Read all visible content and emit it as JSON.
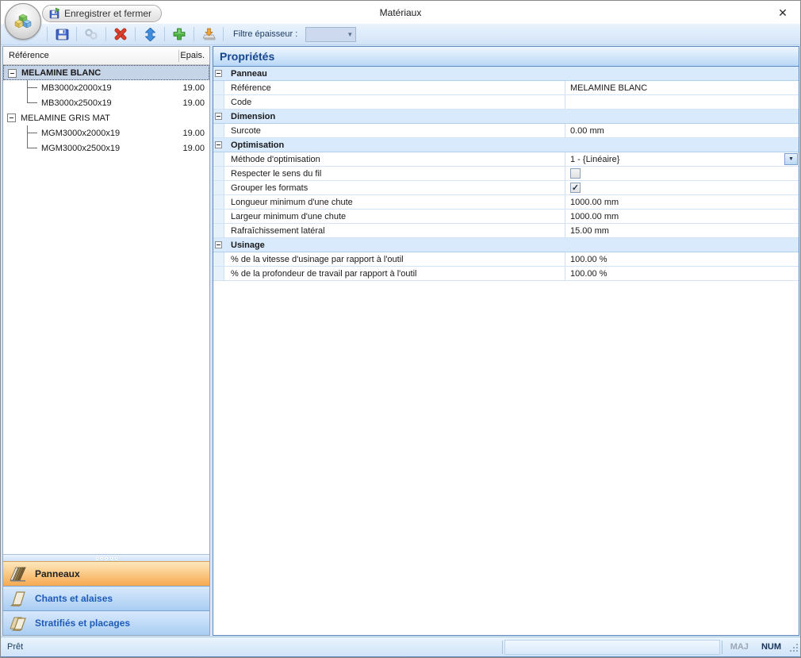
{
  "window": {
    "title": "Matériaux",
    "close_glyph": "✕"
  },
  "quick_access": {
    "save_and_close": "Enregistrer et fermer"
  },
  "toolbar": {
    "filter_label": "Filtre épaisseur :",
    "filter_value": "",
    "icons": [
      "save",
      "link",
      "delete",
      "move-up-down",
      "add",
      "export"
    ]
  },
  "tree": {
    "col_reference": "Référence",
    "col_thickness": "Epais.",
    "rows": [
      {
        "type": "group",
        "label": "MELAMINE BLANC",
        "thickness": "",
        "selected": true,
        "expanded": true
      },
      {
        "type": "child",
        "label": "MB3000x2000x19",
        "thickness": "19.00"
      },
      {
        "type": "child",
        "label": "MB3000x2500x19",
        "thickness": "19.00"
      },
      {
        "type": "group",
        "label": "MELAMINE GRIS MAT",
        "thickness": "",
        "selected": false,
        "expanded": true
      },
      {
        "type": "child",
        "label": "MGM3000x2000x19",
        "thickness": "19.00"
      },
      {
        "type": "child",
        "label": "MGM3000x2500x19",
        "thickness": "19.00"
      }
    ]
  },
  "properties": {
    "title": "Propriétés",
    "rows": [
      {
        "type": "section",
        "label": "Panneau"
      },
      {
        "type": "text",
        "label": "Référence",
        "value": "MELAMINE BLANC"
      },
      {
        "type": "text",
        "label": "Code",
        "value": ""
      },
      {
        "type": "section",
        "label": "Dimension"
      },
      {
        "type": "text",
        "label": "Surcote",
        "value": "0.00 mm"
      },
      {
        "type": "section",
        "label": "Optimisation"
      },
      {
        "type": "dropdown",
        "label": "Méthode d'optimisation",
        "value": "1 - {Linéaire}"
      },
      {
        "type": "checkbox",
        "label": "Respecter le sens du fil",
        "checked": false
      },
      {
        "type": "checkbox",
        "label": "Grouper les formats",
        "checked": true
      },
      {
        "type": "text",
        "label": "Longueur minimum d'une chute",
        "value": "1000.00 mm"
      },
      {
        "type": "text",
        "label": "Largeur minimum d'une chute",
        "value": "1000.00 mm"
      },
      {
        "type": "text",
        "label": "Rafraîchissement latéral",
        "value": "15.00 mm"
      },
      {
        "type": "section",
        "label": "Usinage"
      },
      {
        "type": "text",
        "label": "% de la vitesse d'usinage par rapport à l'outil",
        "value": "100.00 %"
      },
      {
        "type": "text",
        "label": "% de la profondeur de travail par rapport à l'outil",
        "value": "100.00 %"
      }
    ]
  },
  "nav": {
    "items": [
      {
        "label": "Panneaux",
        "active": true,
        "icon": "panels-icon"
      },
      {
        "label": "Chants et alaises",
        "active": false,
        "icon": "edgeband-icon"
      },
      {
        "label": "Stratifiés et placages",
        "active": false,
        "icon": "laminate-icon"
      }
    ]
  },
  "statusbar": {
    "ready": "Prêt",
    "caps_indicator": "MAJ",
    "num_indicator": "NUM"
  },
  "colors": {
    "accent_orange": "#F6A94F",
    "selection_blue": "#C6D4E7",
    "panel_border_blue": "#5E87BF",
    "nav_text_blue": "#1E5BB8",
    "toolbar_blue": "#D2E4F8"
  }
}
